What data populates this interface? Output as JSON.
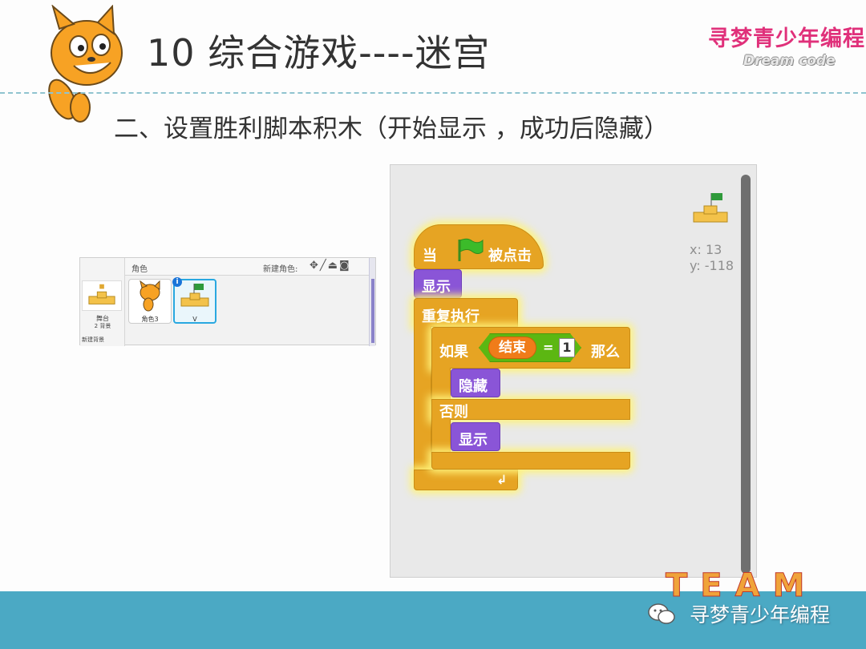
{
  "header": {
    "title": "10 综合游戏----迷宫",
    "brand_cn": "寻梦青少年编程",
    "brand_en": "Dream code"
  },
  "subtitle": "二、设置胜利脚本积木（开始显示 ，成功后隐藏）",
  "sprite_panel": {
    "label": "角色",
    "new_sprite_label": "新建角色:",
    "tool_icons": [
      "paint-brush-icon",
      "pencil-icon",
      "upload-icon",
      "camera-icon"
    ],
    "stage_name": "舞台",
    "stage_count": "2 背景",
    "new_backdrop_label": "新建背景",
    "sprites": [
      {
        "name": "角色3",
        "selected": false
      },
      {
        "name": "V",
        "selected": true
      }
    ]
  },
  "script_area": {
    "coord_x": "x: 13",
    "coord_y": "y: -118",
    "blocks": {
      "when_prefix": "当",
      "when_suffix": "被点击",
      "show_1": "显示",
      "forever": "重复执行",
      "if": "如果",
      "variable": "结束",
      "equals": "=",
      "value": "1",
      "then": "那么",
      "hide": "隐藏",
      "else": "否则",
      "show_2": "显示"
    },
    "colors": {
      "control": "#e6a423",
      "looks": "#8a55d7",
      "operator": "#5cb712",
      "variable": "#f07c1a"
    }
  },
  "footer": {
    "brand_text": "寻梦青少年编程",
    "team_word": "TEAM"
  }
}
